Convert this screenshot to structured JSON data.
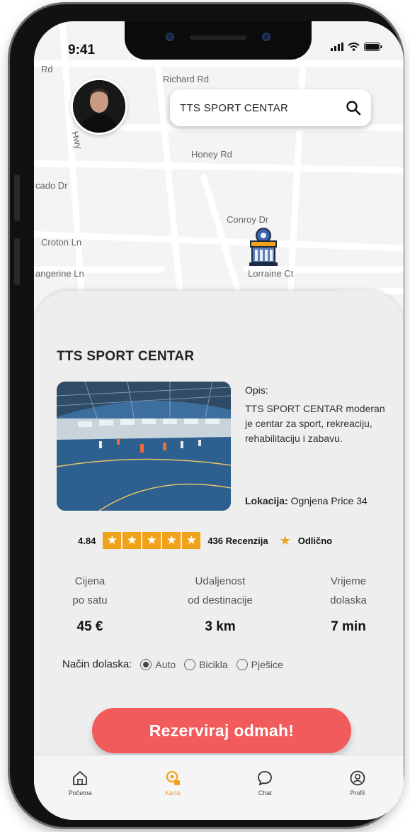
{
  "status": {
    "time": "9:41"
  },
  "search": {
    "value": "TTS SPORT CENTAR"
  },
  "map": {
    "streets": [
      "Richard Rd",
      "Honey Rd",
      "cado Dr",
      "Conroy Dr",
      "Croton Ln",
      "angerine Ln",
      "Lorraine Ct",
      "Rd",
      "Hwy"
    ]
  },
  "venue": {
    "title": "TTS SPORT CENTAR",
    "description_label": "Opis:",
    "description": "TTS SPORT CENTAR moderan je centar za sport, rekreaciju, rehabilitaciju i zabavu.",
    "location_label": "Lokacija:",
    "location": " Ognjena Price 34",
    "rating": "4.84",
    "star_count": 5,
    "reviews": "436 Recenzija",
    "rating_word": "Odlično"
  },
  "stats": [
    {
      "label1": "Cijena",
      "label2": "po satu",
      "value": "45 €"
    },
    {
      "label1": "Udaljenost",
      "label2": "od destinacije",
      "value": "3 km"
    },
    {
      "label1": "Vrijeme",
      "label2": "dolaska",
      "value": "7 min"
    }
  ],
  "arrival_mode": {
    "label": "Način dolaska:",
    "options": [
      "Auto",
      "Bicikla",
      "Pješice"
    ],
    "selected": "Auto"
  },
  "cta": {
    "label": "Rezerviraj odmah!"
  },
  "tabs": [
    {
      "label": "Početna",
      "icon": "home-icon"
    },
    {
      "label": "Karta",
      "icon": "map-pin-icon"
    },
    {
      "label": "Chat",
      "icon": "chat-bubble-icon"
    },
    {
      "label": "Profil",
      "icon": "user-circle-icon"
    }
  ],
  "colors": {
    "accent": "#f0a21a",
    "cta": "#f15b5b"
  }
}
